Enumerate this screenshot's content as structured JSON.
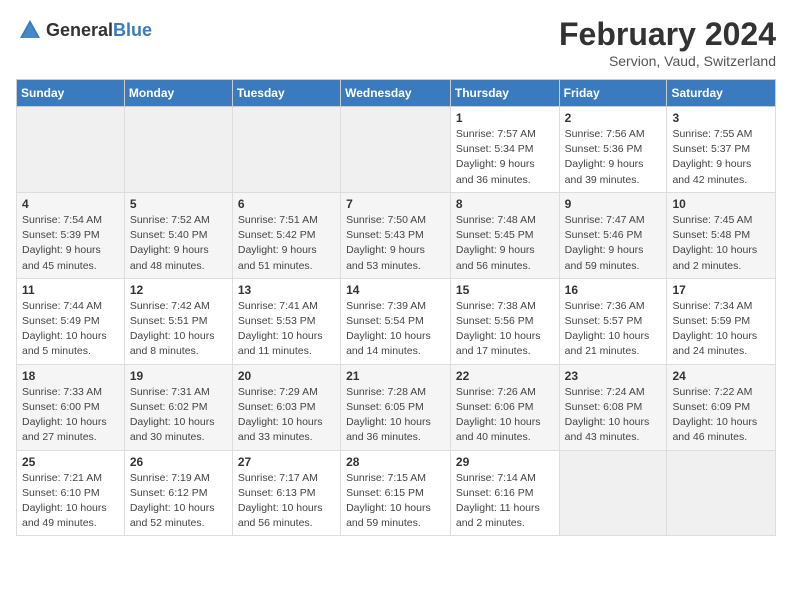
{
  "header": {
    "logo_general": "General",
    "logo_blue": "Blue",
    "month_title": "February 2024",
    "location": "Servion, Vaud, Switzerland"
  },
  "columns": [
    "Sunday",
    "Monday",
    "Tuesday",
    "Wednesday",
    "Thursday",
    "Friday",
    "Saturday"
  ],
  "weeks": [
    [
      {
        "day": "",
        "info": ""
      },
      {
        "day": "",
        "info": ""
      },
      {
        "day": "",
        "info": ""
      },
      {
        "day": "",
        "info": ""
      },
      {
        "day": "1",
        "info": "Sunrise: 7:57 AM\nSunset: 5:34 PM\nDaylight: 9 hours\nand 36 minutes."
      },
      {
        "day": "2",
        "info": "Sunrise: 7:56 AM\nSunset: 5:36 PM\nDaylight: 9 hours\nand 39 minutes."
      },
      {
        "day": "3",
        "info": "Sunrise: 7:55 AM\nSunset: 5:37 PM\nDaylight: 9 hours\nand 42 minutes."
      }
    ],
    [
      {
        "day": "4",
        "info": "Sunrise: 7:54 AM\nSunset: 5:39 PM\nDaylight: 9 hours\nand 45 minutes."
      },
      {
        "day": "5",
        "info": "Sunrise: 7:52 AM\nSunset: 5:40 PM\nDaylight: 9 hours\nand 48 minutes."
      },
      {
        "day": "6",
        "info": "Sunrise: 7:51 AM\nSunset: 5:42 PM\nDaylight: 9 hours\nand 51 minutes."
      },
      {
        "day": "7",
        "info": "Sunrise: 7:50 AM\nSunset: 5:43 PM\nDaylight: 9 hours\nand 53 minutes."
      },
      {
        "day": "8",
        "info": "Sunrise: 7:48 AM\nSunset: 5:45 PM\nDaylight: 9 hours\nand 56 minutes."
      },
      {
        "day": "9",
        "info": "Sunrise: 7:47 AM\nSunset: 5:46 PM\nDaylight: 9 hours\nand 59 minutes."
      },
      {
        "day": "10",
        "info": "Sunrise: 7:45 AM\nSunset: 5:48 PM\nDaylight: 10 hours\nand 2 minutes."
      }
    ],
    [
      {
        "day": "11",
        "info": "Sunrise: 7:44 AM\nSunset: 5:49 PM\nDaylight: 10 hours\nand 5 minutes."
      },
      {
        "day": "12",
        "info": "Sunrise: 7:42 AM\nSunset: 5:51 PM\nDaylight: 10 hours\nand 8 minutes."
      },
      {
        "day": "13",
        "info": "Sunrise: 7:41 AM\nSunset: 5:53 PM\nDaylight: 10 hours\nand 11 minutes."
      },
      {
        "day": "14",
        "info": "Sunrise: 7:39 AM\nSunset: 5:54 PM\nDaylight: 10 hours\nand 14 minutes."
      },
      {
        "day": "15",
        "info": "Sunrise: 7:38 AM\nSunset: 5:56 PM\nDaylight: 10 hours\nand 17 minutes."
      },
      {
        "day": "16",
        "info": "Sunrise: 7:36 AM\nSunset: 5:57 PM\nDaylight: 10 hours\nand 21 minutes."
      },
      {
        "day": "17",
        "info": "Sunrise: 7:34 AM\nSunset: 5:59 PM\nDaylight: 10 hours\nand 24 minutes."
      }
    ],
    [
      {
        "day": "18",
        "info": "Sunrise: 7:33 AM\nSunset: 6:00 PM\nDaylight: 10 hours\nand 27 minutes."
      },
      {
        "day": "19",
        "info": "Sunrise: 7:31 AM\nSunset: 6:02 PM\nDaylight: 10 hours\nand 30 minutes."
      },
      {
        "day": "20",
        "info": "Sunrise: 7:29 AM\nSunset: 6:03 PM\nDaylight: 10 hours\nand 33 minutes."
      },
      {
        "day": "21",
        "info": "Sunrise: 7:28 AM\nSunset: 6:05 PM\nDaylight: 10 hours\nand 36 minutes."
      },
      {
        "day": "22",
        "info": "Sunrise: 7:26 AM\nSunset: 6:06 PM\nDaylight: 10 hours\nand 40 minutes."
      },
      {
        "day": "23",
        "info": "Sunrise: 7:24 AM\nSunset: 6:08 PM\nDaylight: 10 hours\nand 43 minutes."
      },
      {
        "day": "24",
        "info": "Sunrise: 7:22 AM\nSunset: 6:09 PM\nDaylight: 10 hours\nand 46 minutes."
      }
    ],
    [
      {
        "day": "25",
        "info": "Sunrise: 7:21 AM\nSunset: 6:10 PM\nDaylight: 10 hours\nand 49 minutes."
      },
      {
        "day": "26",
        "info": "Sunrise: 7:19 AM\nSunset: 6:12 PM\nDaylight: 10 hours\nand 52 minutes."
      },
      {
        "day": "27",
        "info": "Sunrise: 7:17 AM\nSunset: 6:13 PM\nDaylight: 10 hours\nand 56 minutes."
      },
      {
        "day": "28",
        "info": "Sunrise: 7:15 AM\nSunset: 6:15 PM\nDaylight: 10 hours\nand 59 minutes."
      },
      {
        "day": "29",
        "info": "Sunrise: 7:14 AM\nSunset: 6:16 PM\nDaylight: 11 hours\nand 2 minutes."
      },
      {
        "day": "",
        "info": ""
      },
      {
        "day": "",
        "info": ""
      }
    ]
  ]
}
